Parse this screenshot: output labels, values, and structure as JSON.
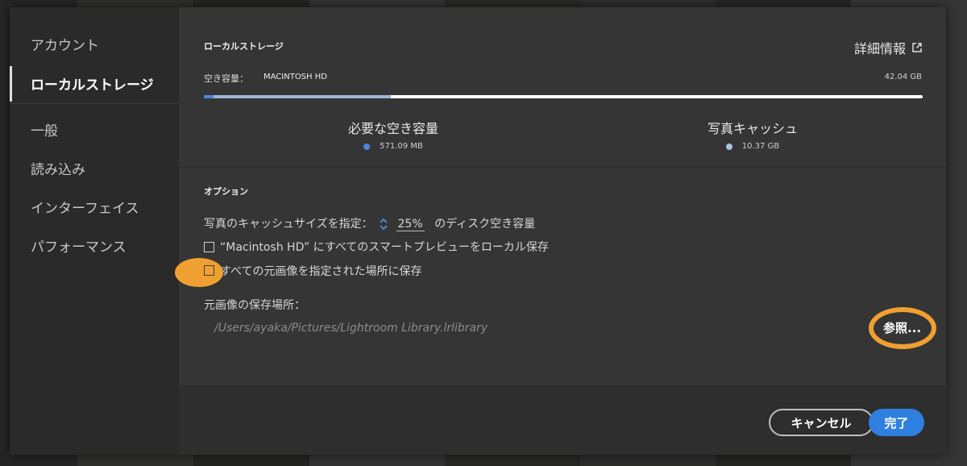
{
  "sidebar": {
    "items": [
      {
        "label": "アカウント",
        "active": false
      },
      {
        "label": "ローカルストレージ",
        "active": true
      },
      {
        "label": "一般",
        "active": false
      },
      {
        "label": "読み込み",
        "active": false
      },
      {
        "label": "インターフェイス",
        "active": false
      },
      {
        "label": "パフォーマンス",
        "active": false
      }
    ]
  },
  "storage": {
    "title": "ローカルストレージ",
    "more_info": "詳細情報",
    "free_label": "空き容量：",
    "disk_name": "MACINTOSH HD",
    "disk_size": "42.04 GB",
    "bar": {
      "required_fraction": 0.013,
      "cache_fraction": 0.247
    },
    "legend": [
      {
        "title": "必要な空き容量",
        "value": "571.09 MB",
        "color": "#4a86dc"
      },
      {
        "title": "写真キャッシュ",
        "value": "10.37 GB",
        "color": "#a7c4e4"
      }
    ]
  },
  "options": {
    "title": "オプション",
    "cache_label": "写真のキャッシュサイズを指定：",
    "cache_value": "25%",
    "cache_suffix": "のディスク空き容量",
    "smart_preview_label": "“Macintosh HD” にすべてのスマートプレビューをローカル保存",
    "originals_label": "すべての元画像を指定された場所に保存",
    "location_label": "元画像の保存場所：",
    "location_path": "/Users/ayaka/Pictures/Lightroom Library.lrlibrary",
    "browse_label": "参照..."
  },
  "footer": {
    "cancel_label": "キャンセル",
    "done_label": "完了"
  },
  "colors": {
    "accent": "#2f7fe0",
    "highlight_marker": "#f0a030"
  }
}
